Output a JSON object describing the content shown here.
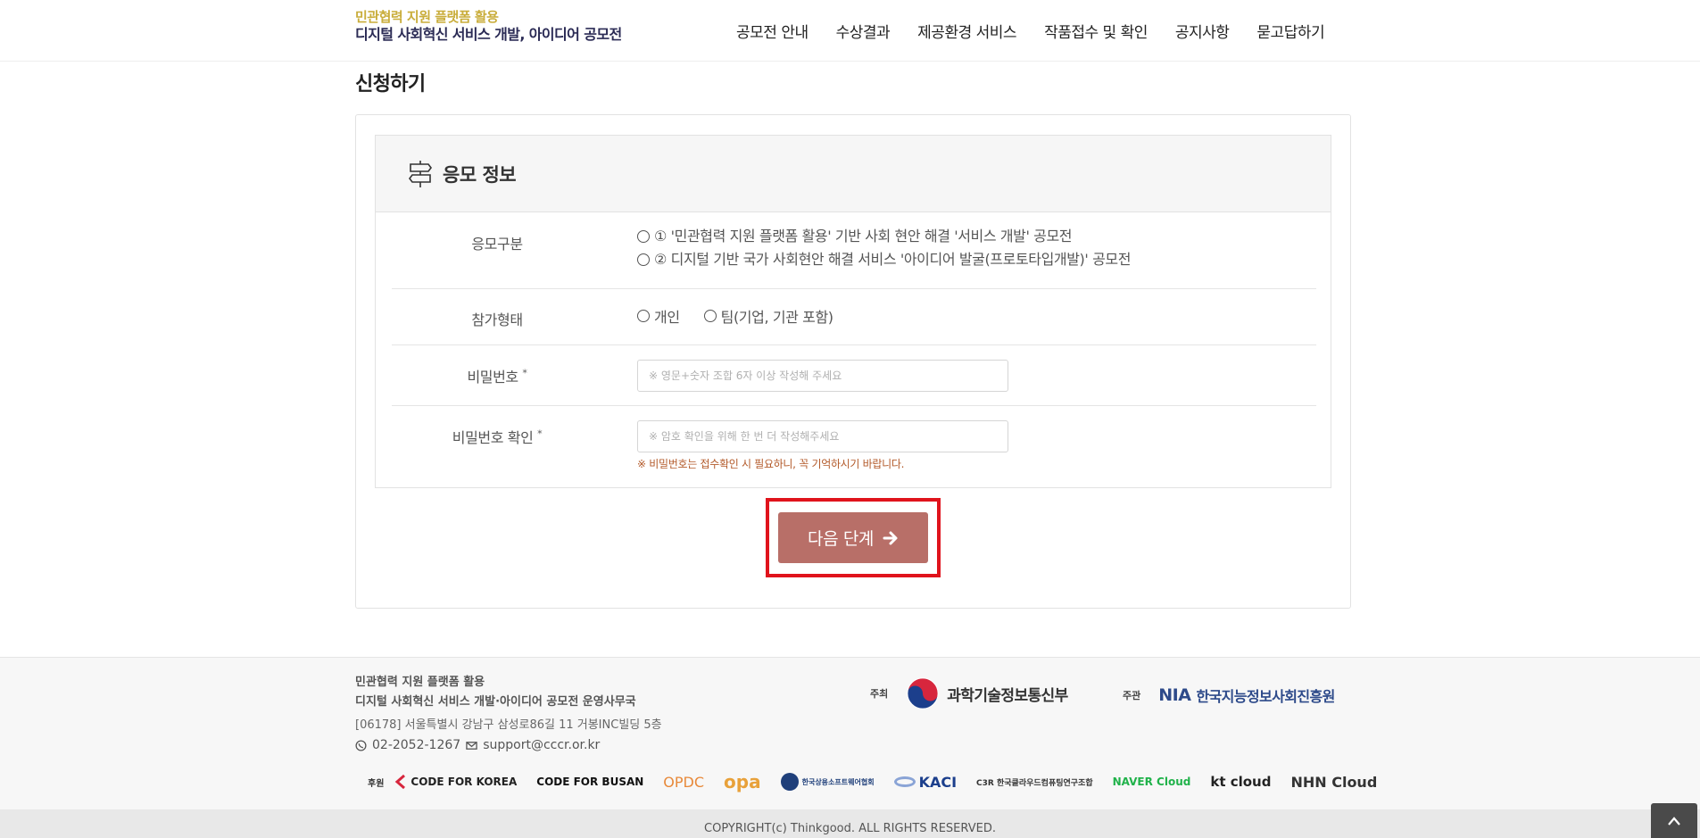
{
  "header": {
    "logo_line1": "민관협력 지원 플랫폼 활용",
    "logo_line2": "디지털 사회혁신 서비스 개발, 아이디어 공모전",
    "nav": [
      "공모전 안내",
      "수상결과",
      "제공환경 서비스",
      "작품접수 및 확인",
      "공지사항",
      "묻고답하기"
    ]
  },
  "page_title": "신청하기",
  "section": {
    "title": "응모 정보",
    "category": {
      "label": "응모구분",
      "options": [
        "① '민관협력 지원 플랫폼 활용' 기반 사회 현안 해결 '서비스 개발' 공모전",
        "② 디지털 기반 국가 사회현안 해결 서비스 '아이디어 발굴(프로토타입개발)' 공모전"
      ]
    },
    "participation": {
      "label": "참가형태",
      "options": [
        "개인",
        "팀(기업, 기관 포함)"
      ]
    },
    "password": {
      "label": "비밀번호",
      "required_mark": "*",
      "placeholder": "※ 영문+숫자 조합 6자 이상 작성해 주세요",
      "value": ""
    },
    "password_confirm": {
      "label": "비밀번호 확인",
      "required_mark": "*",
      "placeholder": "※ 암호 확인을 위해 한 번 더 작성해주세요",
      "value": "",
      "note": "※ 비밀번호는 접수확인 시 필요하니, 꼭 기억하시기 바랍니다."
    }
  },
  "next_button": {
    "label": "다음 단계",
    "icon": "arrow-right-icon",
    "highlight_color": "#e0131c",
    "color": "#b86f68"
  },
  "footer": {
    "org_line1": "민관협력 지원 플랫폼 활용",
    "org_line2": "디지털 사회혁신 서비스 개발·아이디어 공모전 운영사무국",
    "address": "[06178] 서울특별시 강남구 삼성로86길 11 거봉INC빌딩 5층",
    "phone": "02-2052-1267",
    "email": "support@cccr.or.kr",
    "host_tag": "주최",
    "host_name": "과학기술정보통신부",
    "organizer_tag": "주관",
    "organizer_logo": "NIA",
    "organizer_name": "한국지능정보사회진흥원",
    "sponsor_tag": "후원",
    "sponsors": [
      "CODE FOR KOREA",
      "CODE FOR BUSAN",
      "OPDC",
      "opa",
      "한국상용소프트웨어협회",
      "KACI",
      "C3R 한국클라우드컴퓨팅연구조합",
      "NAVER Cloud",
      "kt cloud",
      "NHN Cloud"
    ],
    "copyright": "COPYRIGHT(c) Thinkgood. ALL RIGHTS RESERVED."
  }
}
